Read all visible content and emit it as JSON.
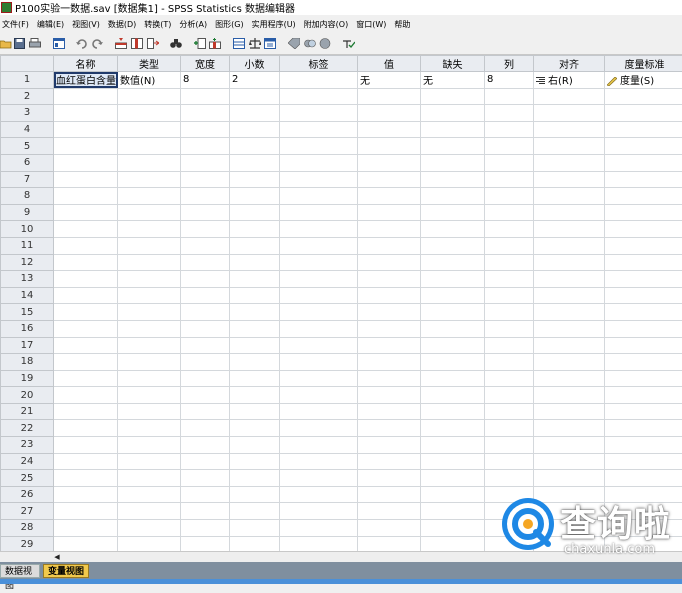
{
  "window": {
    "title": "P100实验一数据.sav [数据集1] - SPSS Statistics 数据编辑器"
  },
  "menu": [
    "文件(F)",
    "编辑(E)",
    "视图(V)",
    "数据(D)",
    "转换(T)",
    "分析(A)",
    "图形(G)",
    "实用程序(U)",
    "附加内容(O)",
    "窗口(W)",
    "帮助"
  ],
  "toolbar": {
    "icons": [
      "open-icon",
      "save-icon",
      "print-icon",
      "dialog-recall-icon",
      "undo-icon",
      "redo-icon",
      "goto-case-icon",
      "goto-variable-icon",
      "variables-icon",
      "find-icon",
      "insert-cases-icon",
      "insert-variable-icon",
      "split-file-icon",
      "weight-cases-icon",
      "select-cases-icon",
      "value-labels-icon",
      "use-sets-icon",
      "show-all-icon",
      "spell-check-icon"
    ]
  },
  "grid": {
    "columns": [
      "名称",
      "类型",
      "宽度",
      "小数",
      "标签",
      "值",
      "缺失",
      "列",
      "对齐",
      "度量标准"
    ],
    "rows": [
      {
        "num": "1",
        "name": "血红蛋白含量",
        "type": "数值(N)",
        "width": "8",
        "decimals": "2",
        "label": "",
        "values": "无",
        "missing": "无",
        "columns": "8",
        "align": "右(R)",
        "measure": "度量(S)"
      }
    ],
    "empty_row_numbers": [
      "2",
      "3",
      "4",
      "5",
      "6",
      "7",
      "8",
      "9",
      "10",
      "11",
      "12",
      "13",
      "14",
      "15",
      "16",
      "17",
      "18",
      "19",
      "20",
      "21",
      "22",
      "23",
      "24",
      "25",
      "26",
      "27",
      "28",
      "29"
    ],
    "align_icon": "align-right-icon",
    "measure_icon": "ruler-icon"
  },
  "hscroll": {
    "left_arrow": "◀"
  },
  "tabs": {
    "data_view": "数据视图",
    "variable_view": "变量视图"
  },
  "watermark": {
    "cn": "查询啦",
    "en": "chaxunla.com",
    "logo_icon": "magnifier-q-icon"
  },
  "colors": {
    "active_tab": "#f2c94c",
    "header_bg": "#e9ecf1",
    "watermark_blue": "#1e88e5",
    "status_bar": "#4a90d9"
  }
}
